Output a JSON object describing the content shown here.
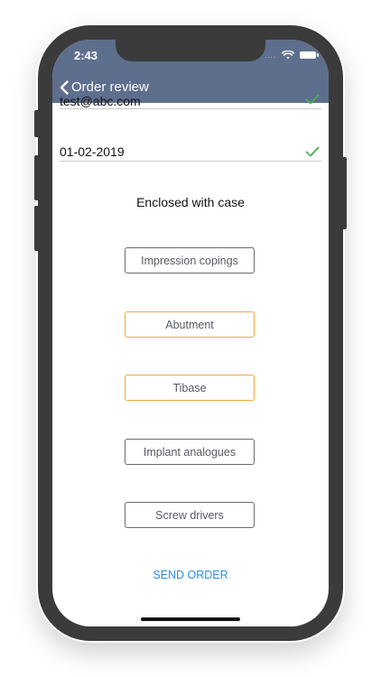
{
  "status_bar": {
    "time": "2:43",
    "signal_dots": "...."
  },
  "nav": {
    "back_label": "Order review"
  },
  "fields": {
    "email_partial": "test@abc.com",
    "date": "01-02-2019"
  },
  "section": {
    "title": "Enclosed with case"
  },
  "options": [
    {
      "label": "Impression copings",
      "selected": false
    },
    {
      "label": "Abutment",
      "selected": true
    },
    {
      "label": "Tibase",
      "selected": true
    },
    {
      "label": "Implant analogues",
      "selected": false
    },
    {
      "label": "Screw drivers",
      "selected": false
    }
  ],
  "action": {
    "send_label": "SEND ORDER"
  },
  "colors": {
    "navbar": "#5e6e8d",
    "selected_border": "#f2a93b",
    "unselected_border": "#6b6b6b",
    "check": "#4caf50",
    "link": "#2d8be6"
  }
}
